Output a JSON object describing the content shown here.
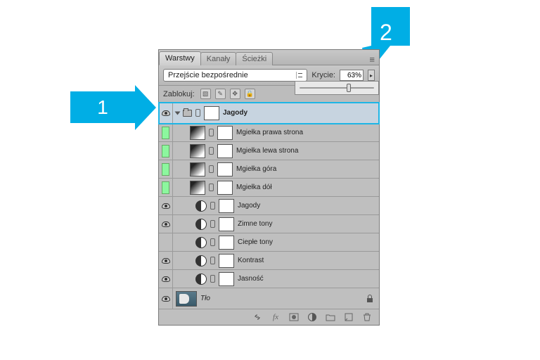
{
  "tabs": {
    "layers": "Warstwy",
    "channels": "Kanały",
    "paths": "Ścieżki"
  },
  "blend": {
    "mode": "Przejście bezpośrednie",
    "opacityLabel": "Krycie:",
    "opacityValue": "63%"
  },
  "lock": {
    "label": "Zablokuj:"
  },
  "layers": {
    "group": "Jagody",
    "l1": "Mgiełka prawa strona",
    "l2": "Mgiełka lewa strona",
    "l3": "Mgiełka góra",
    "l4": "Mgiełka dół",
    "a1": "Jagody",
    "a2": "Zimne tony",
    "a3": "Ciepłe tony",
    "a4": "Kontrast",
    "a5": "Jasność",
    "bg": "Tło"
  },
  "annotations": {
    "one": "1",
    "two": "2"
  },
  "sliderPercent": 63
}
